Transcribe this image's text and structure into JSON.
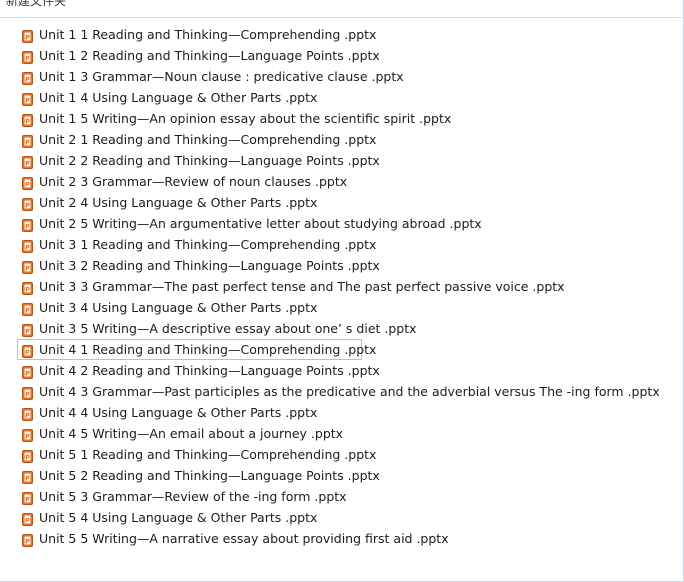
{
  "folder": {
    "title": "新建文件夹"
  },
  "icon": "powerpoint-file-icon",
  "colors": {
    "icon_orange": "#e5752c",
    "focus_border": "#a6c6e8"
  },
  "files": [
    {
      "name": "Unit 1 1 Reading and Thinking—Comprehending  .pptx"
    },
    {
      "name": "Unit 1 2 Reading and Thinking—Language Points  .pptx"
    },
    {
      "name": "Unit 1 3 Grammar—Noun clause : predicative clause  .pptx"
    },
    {
      "name": "Unit 1 4 Using Language & Other Parts  .pptx"
    },
    {
      "name": "Unit 1 5 Writing—An opinion essay about the scientific spirit  .pptx"
    },
    {
      "name": "Unit 2 1 Reading and Thinking—Comprehending  .pptx"
    },
    {
      "name": "Unit 2 2 Reading and Thinking—Language Points  .pptx"
    },
    {
      "name": "Unit 2 3 Grammar—Review of noun clauses  .pptx"
    },
    {
      "name": "Unit 2 4 Using Language & Other Parts  .pptx"
    },
    {
      "name": "Unit 2 5 Writing—An argumentative letter about studying abroad  .pptx"
    },
    {
      "name": "Unit 3 1 Reading and Thinking—Comprehending  .pptx"
    },
    {
      "name": "Unit 3 2 Reading and Thinking—Language Points  .pptx"
    },
    {
      "name": "Unit 3 3 Grammar—The past perfect tense and The past perfect passive voice  .pptx"
    },
    {
      "name": "Unit 3 4 Using Language & Other Parts  .pptx"
    },
    {
      "name": "Unit 3 5 Writing—A descriptive essay about one’ s diet  .pptx"
    },
    {
      "name": "Unit 4 1 Reading and Thinking—Comprehending  .pptx",
      "focused": true
    },
    {
      "name": "Unit 4 2 Reading and Thinking—Language Points  .pptx"
    },
    {
      "name": "Unit 4 3 Grammar—Past participles as the predicative and the adverbial versus The -ing form  .pptx"
    },
    {
      "name": "Unit 4 4 Using Language & Other Parts  .pptx"
    },
    {
      "name": "Unit 4 5 Writing—An email about a journey  .pptx"
    },
    {
      "name": "Unit 5 1 Reading and Thinking—Comprehending  .pptx"
    },
    {
      "name": "Unit 5 2 Reading and Thinking—Language Points  .pptx"
    },
    {
      "name": "Unit 5 3 Grammar—Review of the -ing form  .pptx"
    },
    {
      "name": "Unit 5 4 Using Language & Other Parts  .pptx"
    },
    {
      "name": "Unit 5 5 Writing—A narrative essay about providing first aid  .pptx"
    }
  ]
}
